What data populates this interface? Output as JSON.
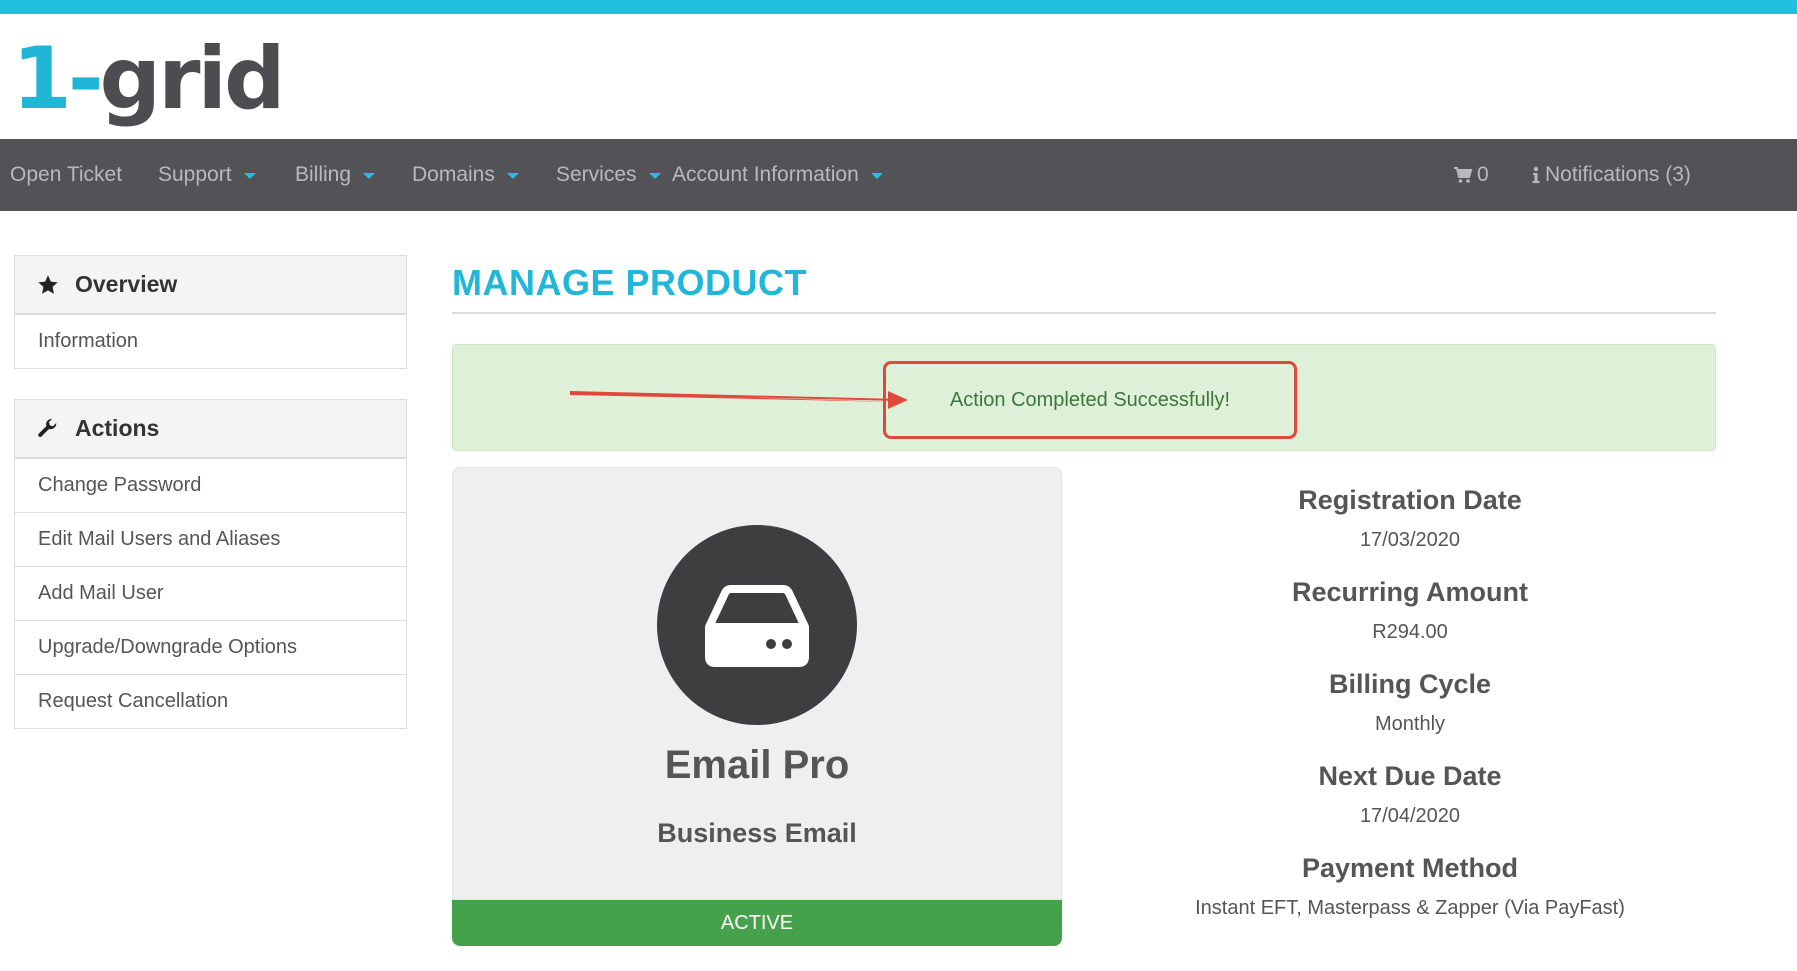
{
  "brand": {
    "logo_one": "1",
    "logo_dash": "-",
    "logo_rest": "grid"
  },
  "nav": {
    "items": [
      {
        "label": "Open Ticket"
      },
      {
        "label": "Support"
      },
      {
        "label": "Billing"
      },
      {
        "label": "Domains"
      },
      {
        "label": "Services"
      },
      {
        "label": "Account Information"
      }
    ],
    "cart_count": "0",
    "notifications_label": "Notifications (3)"
  },
  "sidebar": {
    "overview": {
      "title": "Overview",
      "items": [
        {
          "label": "Information"
        }
      ]
    },
    "actions": {
      "title": "Actions",
      "items": [
        {
          "label": "Change Password"
        },
        {
          "label": "Edit Mail Users and Aliases"
        },
        {
          "label": "Add Mail User"
        },
        {
          "label": "Upgrade/Downgrade Options"
        },
        {
          "label": "Request Cancellation"
        }
      ]
    }
  },
  "main": {
    "title": "MANAGE PRODUCT",
    "alert_message": "Action Completed Successfully!",
    "product": {
      "name": "Email Pro",
      "group": "Business Email",
      "status": "ACTIVE",
      "icon": "hard-drive-icon"
    },
    "details": [
      {
        "label": "Registration Date",
        "value": "17/03/2020"
      },
      {
        "label": "Recurring Amount",
        "value": "R294.00"
      },
      {
        "label": "Billing Cycle",
        "value": "Monthly"
      },
      {
        "label": "Next Due Date",
        "value": "17/04/2020"
      },
      {
        "label": "Payment Method",
        "value": "Instant EFT, Masterpass & Zapper (Via PayFast)"
      }
    ]
  },
  "colors": {
    "accent": "#22bfe0",
    "navbar": "#535357",
    "alert_bg": "#dff0d8",
    "alert_text": "#3c763d",
    "annotation": "#e0483b",
    "status_active": "#45a24a"
  }
}
